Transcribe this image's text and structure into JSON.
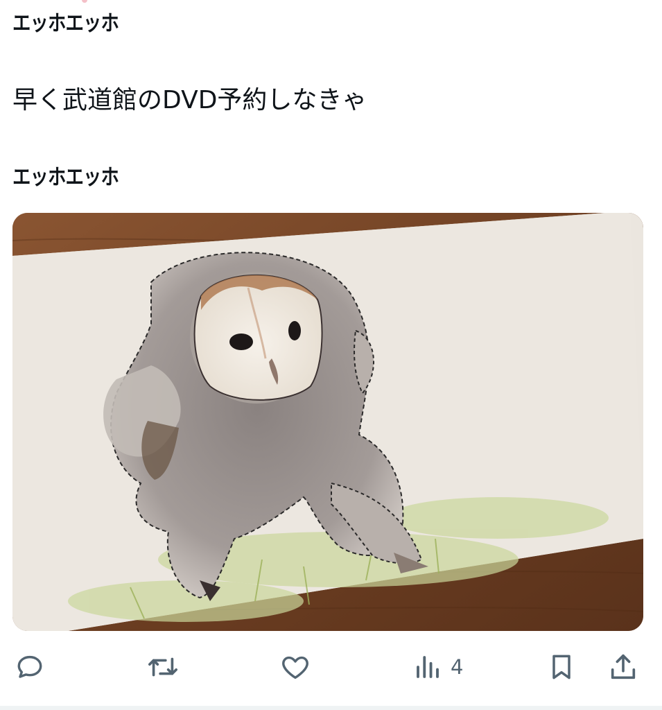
{
  "quoted_caption": "エッホエッホ",
  "tweet": {
    "text": "早く武道館のDVD予約しなきゃ",
    "caption": "エッホエッホ"
  },
  "media": {
    "description_icon": "owl-watercolor-image"
  },
  "actions": {
    "reply_icon": "reply-icon",
    "retweet_icon": "retweet-icon",
    "like_icon": "like-icon",
    "views_icon": "views-icon",
    "views_count": "4",
    "bookmark_icon": "bookmark-icon",
    "share_icon": "share-icon"
  },
  "colors": {
    "text": "#0f1419",
    "icon": "#536471"
  }
}
